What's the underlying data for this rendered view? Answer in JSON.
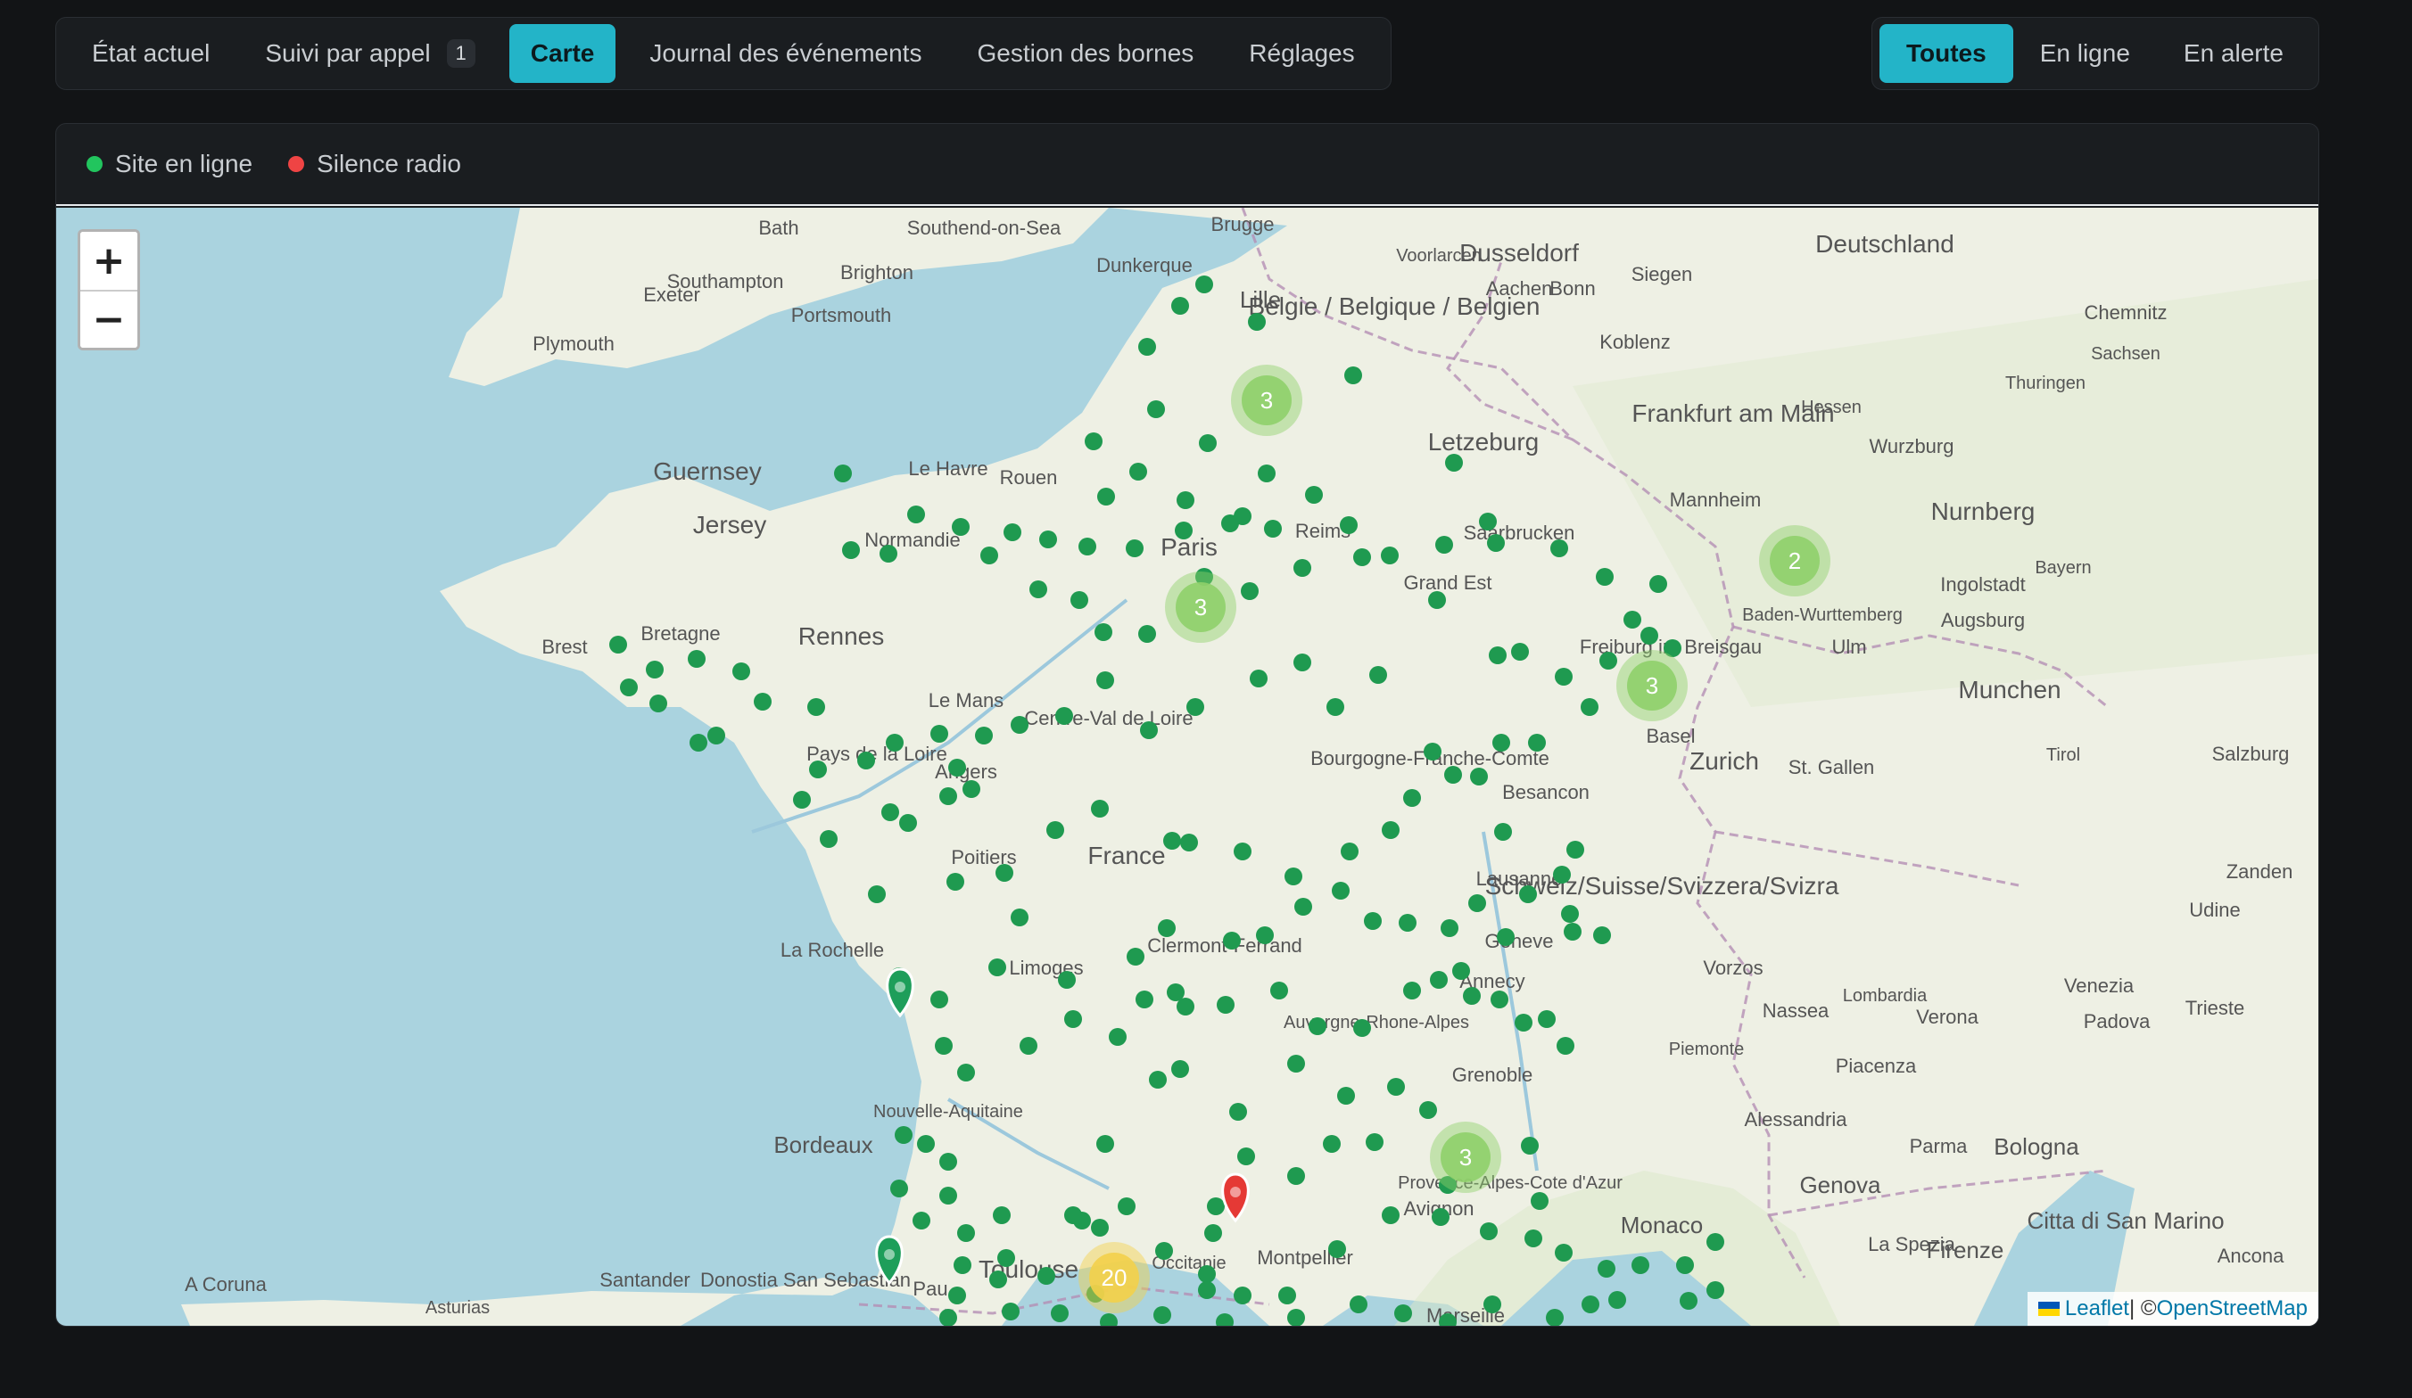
{
  "tabs": [
    {
      "label": "État actuel",
      "active": false
    },
    {
      "label": "Suivi par appel",
      "active": false,
      "badge": "1"
    },
    {
      "label": "Carte",
      "active": true
    },
    {
      "label": "Journal des événements",
      "active": false
    },
    {
      "label": "Gestion des bornes",
      "active": false
    },
    {
      "label": "Réglages",
      "active": false
    }
  ],
  "filters": [
    {
      "label": "Toutes",
      "active": true
    },
    {
      "label": "En ligne",
      "active": false
    },
    {
      "label": "En alerte",
      "active": false
    }
  ],
  "legend": [
    {
      "label": "Site en ligne",
      "color": "#22c55e"
    },
    {
      "label": "Silence radio",
      "color": "#ef4444"
    }
  ],
  "map": {
    "zoom_in": "+",
    "zoom_out": "−",
    "attribution": {
      "leaflet": "Leaflet",
      "separator": " | © ",
      "osm": "OpenStreetMap"
    },
    "colors": {
      "water": "#aad3df",
      "land": "#eef0e4",
      "land_forest": "#d9e8c8",
      "marker": "#1f9a50",
      "cluster_green": "#8fd06a",
      "cluster_yellow": "#f3d04a",
      "alert": "#e53935"
    },
    "labels": [
      "Bath",
      "Southampton",
      "Brighton",
      "Portsmouth",
      "Exeter",
      "Plymouth",
      "Southend-on-Sea",
      "Brugge",
      "Dunkerque",
      "Lille",
      "Dusseldorf",
      "Belgie / Belgique / Belgien",
      "Voorlarcen",
      "Aachen",
      "Bonn",
      "Siegen",
      "Koblenz",
      "Deutschland",
      "Chemnitz",
      "Frankfurt am Main",
      "Wurzburg",
      "Nurnberg",
      "Mannheim",
      "Letzeburg",
      "Saarbrucken",
      "Guernsey",
      "Jersey",
      "Le Havre",
      "Rouen",
      "Paris",
      "Reims",
      "Brest",
      "Bretagne",
      "Rennes",
      "Le Mans",
      "Normandie",
      "Grand Est",
      "Ingolstadt",
      "Augsburg",
      "Munchen",
      "Ulm",
      "Freiburg im Breisgau",
      "Basel",
      "Zurich",
      "St. Gallen",
      "Besancon",
      "Bourgogne-Franche-Comte",
      "Centre-Val de Loire",
      "Angers",
      "Pays de la Loire",
      "France",
      "Poitiers",
      "Lausanne",
      "Schweiz/Suisse/Svizzera/Svizra",
      "Geneve",
      "La Rochelle",
      "Limoges",
      "Clermont-Ferrand",
      "Annecy",
      "Vorzos",
      "Udine",
      "Trieste",
      "Padova",
      "Venezia",
      "Verona",
      "Nassea",
      "Lombardia",
      "Auvergne-Rhone-Alpes",
      "Grenoble",
      "Piemonte",
      "Piacenza",
      "Alessandria",
      "Parma",
      "Bologna",
      "Genova",
      "Bordeaux",
      "Nouvelle-Aquitaine",
      "Provence-Alpes-Cote d'Azur",
      "Avignon",
      "Monaco",
      "La Spezia",
      "Firenze",
      "Citta di San Marino",
      "Ancona",
      "Montpellier",
      "Occitanie",
      "Toulouse",
      "Pau",
      "Donostia San Sebastian",
      "Santander",
      "A Coruna",
      "Asturias",
      "Marseille",
      "Baden-Wurttemberg",
      "Bayern",
      "Thuringen",
      "Sachsen",
      "Hessen",
      "Tirol",
      "Salzburg",
      "Zanden"
    ],
    "clusters": [
      {
        "count": "3",
        "color": "green"
      },
      {
        "count": "3",
        "color": "green"
      },
      {
        "count": "2",
        "color": "green"
      },
      {
        "count": "3",
        "color": "green"
      },
      {
        "count": "3",
        "color": "green"
      },
      {
        "count": "20",
        "color": "yellow"
      }
    ]
  }
}
